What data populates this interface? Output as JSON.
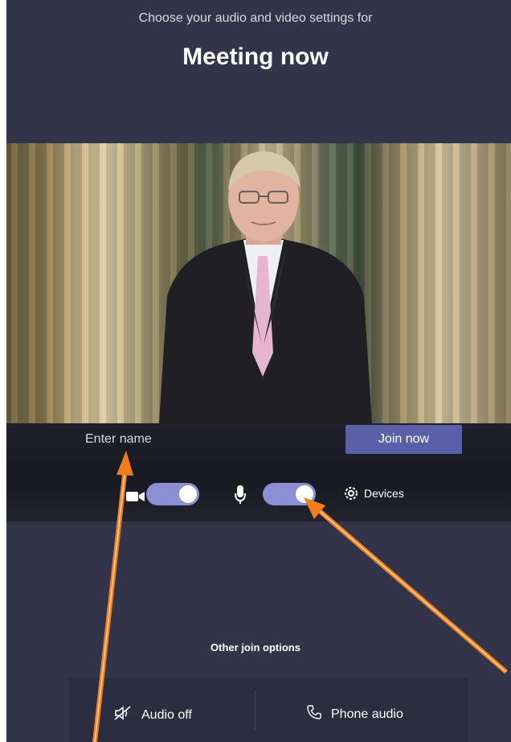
{
  "header": {
    "subtitle": "Choose your audio and video settings for",
    "title": "Meeting now"
  },
  "join": {
    "name_placeholder": "Enter name",
    "join_label": "Join now"
  },
  "controls": {
    "camera_on": true,
    "mic_on": true,
    "devices_label": "Devices"
  },
  "other_options": {
    "heading": "Other join options",
    "audio_off_label": "Audio off",
    "phone_audio_label": "Phone audio"
  },
  "colors": {
    "background": "#33344a",
    "accent": "#5b5fa8",
    "toggle": "#8c8fd4",
    "annotation_arrow": "#f07f1a"
  },
  "icons": [
    "camera-icon",
    "microphone-icon",
    "gear-icon",
    "speaker-off-icon",
    "phone-icon"
  ]
}
